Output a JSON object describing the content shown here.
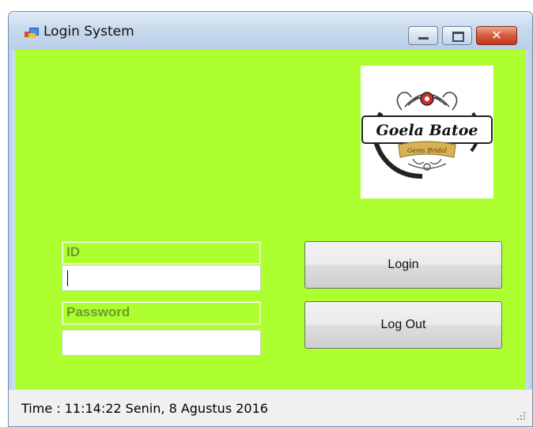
{
  "window": {
    "title": "Login System",
    "controls": [
      "minimize",
      "maximize",
      "close"
    ]
  },
  "logo": {
    "brand_text": "Goela Batoe",
    "sub_text": "Gems Bridal"
  },
  "form": {
    "id_label": "ID",
    "id_value": "",
    "password_label": "Password",
    "password_value": ""
  },
  "buttons": {
    "login_label": "Login",
    "logout_label": "Log Out"
  },
  "status": {
    "text": "Time :  11:14:22  Senin, 8 Agustus 2016"
  },
  "colors": {
    "form_background": "#adff2f",
    "label_text": "#6f9a2c"
  },
  "icons": {
    "app": "app-icon",
    "minimize": "minimize-icon",
    "maximize": "maximize-icon",
    "close": "close-icon"
  }
}
